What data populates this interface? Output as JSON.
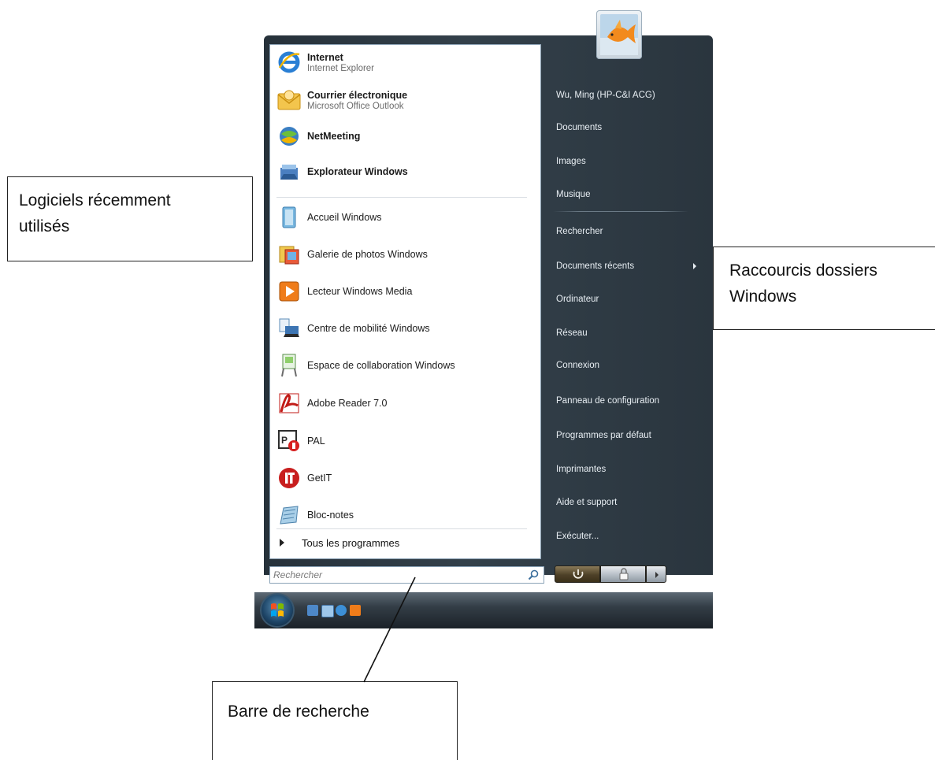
{
  "annotations": {
    "recent_software": [
      "Logiciels récemment",
      "utilisés"
    ],
    "folder_shortcuts": [
      "Raccourcis dossiers",
      "Windows"
    ],
    "search_bar": "Barre de recherche"
  },
  "left_pane": {
    "pinned": [
      {
        "title": "Internet",
        "subtitle": "Internet Explorer",
        "icon": "internet-explorer-icon"
      },
      {
        "title": "Courrier électronique",
        "subtitle": "Microsoft Office Outlook",
        "icon": "outlook-icon"
      },
      {
        "title": "NetMeeting",
        "subtitle": "",
        "icon": "netmeeting-icon"
      },
      {
        "title": "Explorateur Windows",
        "subtitle": "",
        "icon": "windows-explorer-icon"
      }
    ],
    "recent": [
      {
        "title": "Accueil Windows",
        "icon": "welcome-center-icon"
      },
      {
        "title": "Galerie de photos Windows",
        "icon": "photo-gallery-icon"
      },
      {
        "title": "Lecteur Windows Media",
        "icon": "media-player-icon"
      },
      {
        "title": "Centre de mobilité Windows",
        "icon": "mobility-center-icon"
      },
      {
        "title": "Espace de collaboration Windows",
        "icon": "meeting-space-icon"
      },
      {
        "title": "Adobe Reader 7.0",
        "icon": "adobe-reader-icon"
      },
      {
        "title": "PAL",
        "icon": "pal-icon"
      },
      {
        "title": "GetIT",
        "icon": "getit-icon"
      },
      {
        "title": "Bloc-notes",
        "icon": "notepad-icon"
      }
    ],
    "all_programs": "Tous les programmes"
  },
  "search": {
    "placeholder": "Rechercher"
  },
  "right_pane": {
    "user_name": "Wu, Ming (HP-C&I ACG)",
    "links": [
      "Documents",
      "Images",
      "Musique",
      "Rechercher",
      "Documents récents",
      "Ordinateur",
      "Réseau",
      "Connexion",
      "Panneau de configuration",
      "Programmes par défaut",
      "Imprimantes",
      "Aide et support",
      "Exécuter..."
    ]
  },
  "colors": {
    "menu_dark": "#2c3740",
    "pane_white": "#ffffff",
    "link_text": "#e8eef3"
  }
}
